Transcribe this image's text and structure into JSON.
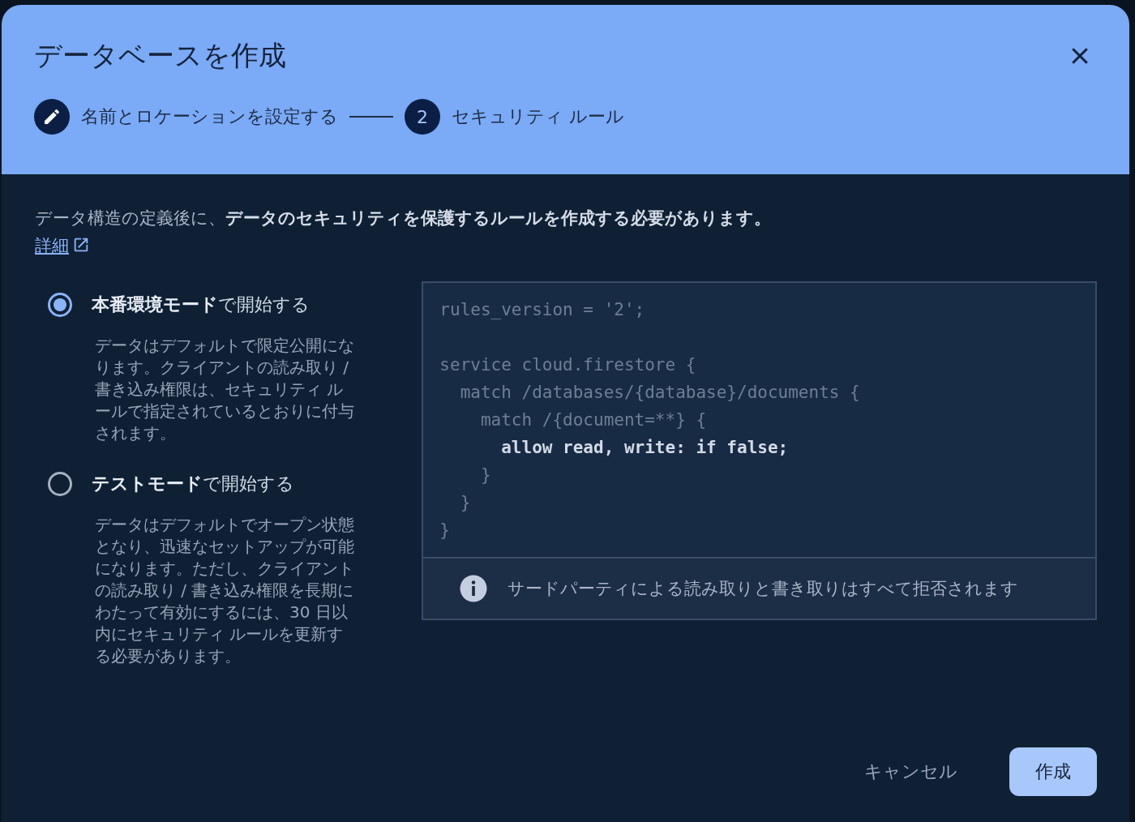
{
  "dialog": {
    "title": "データベースを作成"
  },
  "steps": [
    {
      "kind": "done",
      "label": "名前とロケーションを設定する"
    },
    {
      "kind": "current",
      "number": "2",
      "label": "セキュリティ ルール"
    }
  ],
  "intro": "データ構造の定義後に、**データのセキュリティを保護するルールを作成する必要があります。**",
  "learn_more_link": "詳細",
  "options": [
    {
      "label": "**本番環境モード**で開始する",
      "description": "データはデフォルトで限定公開になります。クライアントの読み取り / 書き込み権限は、セキュリティ ルールで指定されているとおりに付与されます。",
      "selected": true
    },
    {
      "label": "**テストモード**で開始する",
      "description": "データはデフォルトでオープン状態となり、迅速なセットアップが可能になります。ただし、クライアントの読み取り / 書き込み権限を長期にわたって有効にするには、30 日以内にセキュリティ ルールを更新する必要があります。",
      "selected": false
    }
  ],
  "code_lines": [
    {
      "kind": "line",
      "text": "rules_version = '2';",
      "bold": false
    },
    {
      "kind": "blank"
    },
    {
      "kind": "line",
      "text": "service cloud.firestore {",
      "bold": false
    },
    {
      "kind": "line",
      "text": "  match /databases/{database}/documents {",
      "bold": false
    },
    {
      "kind": "line",
      "text": "    match /{document=**} {",
      "bold": false
    },
    {
      "kind": "line",
      "text": "      allow read, write: if false;",
      "bold": true
    },
    {
      "kind": "line",
      "text": "    }",
      "bold": false
    },
    {
      "kind": "line",
      "text": "  }",
      "bold": false
    },
    {
      "kind": "line",
      "text": "}",
      "bold": false
    }
  ],
  "info_message": "サードパーティによる読み取りと書き取りはすべて拒否されます",
  "buttons": [
    {
      "kind": "text",
      "label": "キャンセル"
    },
    {
      "kind": "filled",
      "label": "作成"
    }
  ]
}
